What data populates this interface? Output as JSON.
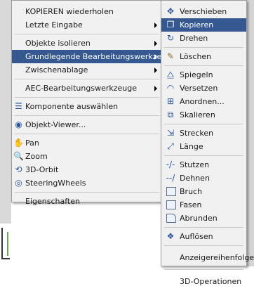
{
  "main_menu": {
    "items": [
      {
        "label": "KOPIEREN wiederholen"
      },
      {
        "label": "Letzte Eingabe"
      },
      {
        "label": "Objekte isolieren"
      },
      {
        "label": "Grundlegende Bearbeitungswerkzeuge"
      },
      {
        "label": "Zwischenablage"
      },
      {
        "label": "AEC-Bearbeitungswerkzeuge"
      },
      {
        "label": "Komponente auswählen"
      },
      {
        "label": "Objekt-Viewer..."
      },
      {
        "label": "Pan"
      },
      {
        "label": "Zoom"
      },
      {
        "label": "3D-Orbit"
      },
      {
        "label": "SteeringWheels"
      },
      {
        "label": "Eigenschaften"
      }
    ]
  },
  "sub_menu": {
    "items": [
      {
        "label": "Verschieben",
        "icon": "move-icon"
      },
      {
        "label": "Kopieren",
        "icon": "copy-icon"
      },
      {
        "label": "Drehen",
        "icon": "rotate-icon"
      },
      {
        "label": "Löschen",
        "icon": "erase-icon"
      },
      {
        "label": "Spiegeln",
        "icon": "mirror-icon"
      },
      {
        "label": "Versetzen",
        "icon": "offset-icon"
      },
      {
        "label": "Anordnen...",
        "icon": "array-icon"
      },
      {
        "label": "Skalieren",
        "icon": "scale-icon"
      },
      {
        "label": "Strecken",
        "icon": "stretch-icon"
      },
      {
        "label": "Länge",
        "icon": "lengthen-icon"
      },
      {
        "label": "Stutzen",
        "icon": "trim-icon"
      },
      {
        "label": "Dehnen",
        "icon": "extend-icon"
      },
      {
        "label": "Bruch",
        "icon": "break-icon"
      },
      {
        "label": "Fasen",
        "icon": "chamfer-icon"
      },
      {
        "label": "Abrunden",
        "icon": "fillet-icon"
      },
      {
        "label": "Auflösen",
        "icon": "explode-icon"
      },
      {
        "label": "Anzeigereihenfolge"
      },
      {
        "label": "3D-Operationen"
      }
    ]
  },
  "colors": {
    "highlight": "#34588f",
    "menu_bg": "#f1f1f1"
  }
}
